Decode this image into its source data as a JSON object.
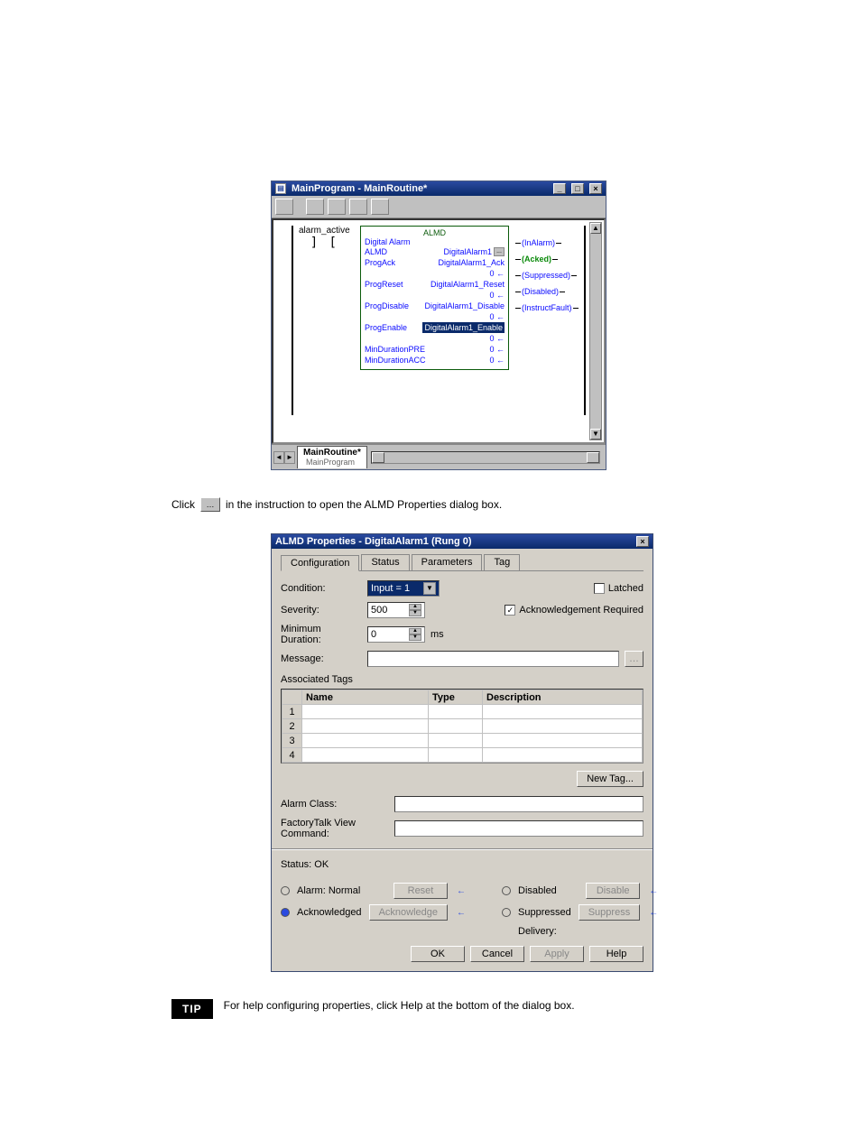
{
  "ladder_win": {
    "title": "MainProgram - MainRoutine*",
    "rung_input_label": "alarm_active",
    "almd": {
      "header": "ALMD",
      "caption": "Digital Alarm",
      "rows": [
        {
          "k": "ALMD",
          "v": "DigitalAlarm1",
          "btn": "..."
        },
        {
          "k": "ProgAck",
          "v": "DigitalAlarm1_Ack"
        },
        {
          "k": "",
          "v": "0 ←"
        },
        {
          "k": "ProgReset",
          "v": "DigitalAlarm1_Reset"
        },
        {
          "k": "",
          "v": "0 ←"
        },
        {
          "k": "ProgDisable",
          "v": "DigitalAlarm1_Disable"
        },
        {
          "k": "",
          "v": "0 ←"
        },
        {
          "k": "ProgEnable",
          "v": "DigitalAlarm1_Enable",
          "hl": true
        },
        {
          "k": "",
          "v": "0 ←"
        },
        {
          "k": "MinDurationPRE",
          "v": "0 ←"
        },
        {
          "k": "MinDurationACC",
          "v": "0 ←"
        }
      ]
    },
    "outputs": [
      {
        "label": "(InAlarm)",
        "green": false
      },
      {
        "label": "(Acked)",
        "green": true
      },
      {
        "label": "(Suppressed)",
        "green": false
      },
      {
        "label": "(Disabled)",
        "green": false
      },
      {
        "label": "(InstructFault)",
        "green": false
      }
    ],
    "tab_main": "MainRoutine*",
    "tab_sub": "MainProgram"
  },
  "between_text_1": "Click ",
  "between_text_2": " in the instruction to open the ALMD Properties dialog box.",
  "dlg": {
    "title": "ALMD Properties - DigitalAlarm1 (Rung 0)",
    "tabs": [
      "Configuration",
      "Status",
      "Parameters",
      "Tag"
    ],
    "condition_label": "Condition:",
    "condition_value": "Input = 1",
    "severity_label": "Severity:",
    "severity_value": "500",
    "mindur_label": "Minimum Duration:",
    "mindur_value": "0",
    "mindur_unit": "ms",
    "latched_label": "Latched",
    "ackreq_label": "Acknowledgement Required",
    "message_label": "Message:",
    "assoc_label": "Associated Tags",
    "grid_headers": [
      "",
      "Name",
      "Type",
      "Description"
    ],
    "grid_rows": [
      "1",
      "2",
      "3",
      "4"
    ],
    "newtag_label": "New Tag...",
    "alarmclass_label": "Alarm Class:",
    "ftv_label": "FactoryTalk View Command:",
    "status_label": "Status:  OK",
    "alarm_normal": "Alarm: Normal",
    "acknowledged": "Acknowledged",
    "disabled": "Disabled",
    "suppressed": "Suppressed",
    "delivery": "Delivery:",
    "reset_btn": "Reset",
    "ack_btn": "Acknowledge",
    "disable_btn": "Disable",
    "suppress_btn": "Suppress",
    "ok": "OK",
    "cancel": "Cancel",
    "apply": "Apply",
    "help": "Help"
  },
  "tip": {
    "badge": "TIP",
    "text": "For help configuring properties, click Help at the bottom of the dialog box."
  }
}
